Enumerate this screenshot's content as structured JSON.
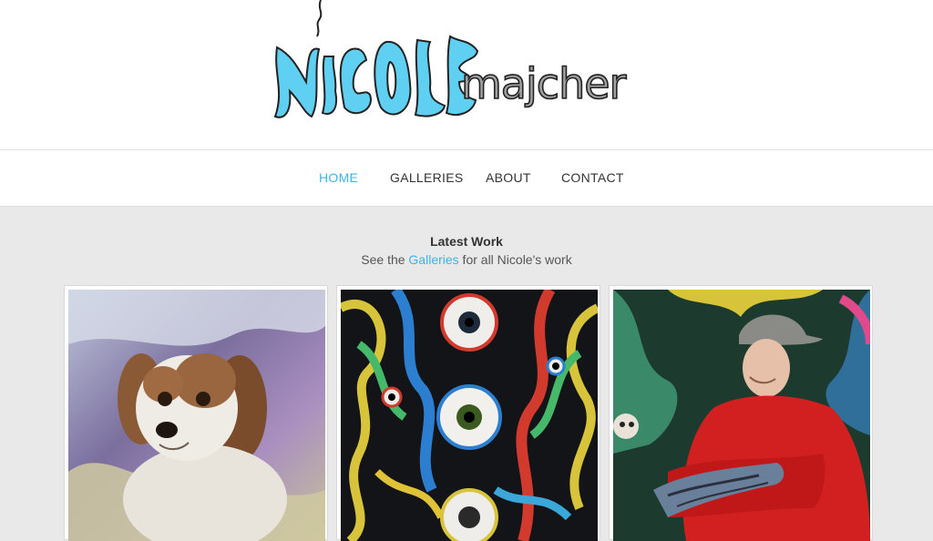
{
  "site": {
    "logo_part1": "NiCOLE",
    "logo_part2": "majcher"
  },
  "nav": {
    "items": [
      {
        "label": "HOME",
        "active": true
      },
      {
        "label": "GALLERIES",
        "active": false
      },
      {
        "label": "ABOUT",
        "active": false
      },
      {
        "label": "CONTACT",
        "active": false
      }
    ]
  },
  "latest": {
    "title": "Latest Work",
    "sub_prefix": "See the ",
    "sub_link": "Galleries",
    "sub_suffix": " for all Nicole's work"
  },
  "gallery": {
    "items": [
      {
        "subject": "painting of a spaniel dog"
      },
      {
        "subject": "psychedelic painting with eyeballs"
      },
      {
        "subject": "painting of a young man in red with tattoos"
      }
    ]
  },
  "colors": {
    "accent": "#3bb4e6",
    "logo_blue": "#5fd0f2",
    "logo_gray": "#a0a0a0",
    "page_bg": "#e9e9e9"
  }
}
